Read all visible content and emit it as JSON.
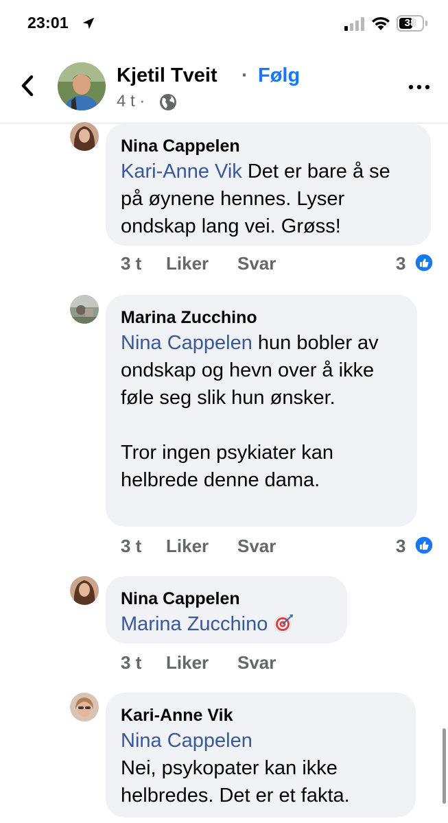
{
  "status_bar": {
    "time": "23:01",
    "battery": "38"
  },
  "header": {
    "author": "Kjetil Tveit",
    "separator": "·",
    "follow": "Følg",
    "time": "4 t ·"
  },
  "comments": [
    {
      "name": "Nina Cappelen",
      "mention": "Kari-Anne Vik",
      "text": " Det er bare å se på øynene hennes. Lyser ondskap lang vei. Grøss!",
      "time": "3 t",
      "like": "Liker",
      "reply": "Svar",
      "reactions": "3"
    },
    {
      "name": "Marina Zucchino",
      "mention": "Nina Cappelen",
      "text": " hun bobler av ondskap og hevn over å ikke føle seg slik hun ønsker.\n\nTror ingen psykiater kan helbrede denne dama.",
      "time": "3 t",
      "like": "Liker",
      "reply": "Svar",
      "reactions": "3"
    },
    {
      "name": "Nina Cappelen",
      "mention": "Marina Zucchino",
      "text": "",
      "emoji": "🎯",
      "time": "3 t",
      "like": "Liker",
      "reply": "Svar"
    },
    {
      "name": "Kari-Anne Vik",
      "mention": "Nina Cappelen",
      "text": "Nei, psykopater kan ikke helbredes. Det er et fakta."
    }
  ],
  "colors": {
    "accent": "#1877f2",
    "mention": "#385898",
    "bubble": "#f0f2f5",
    "meta": "#65676b"
  }
}
